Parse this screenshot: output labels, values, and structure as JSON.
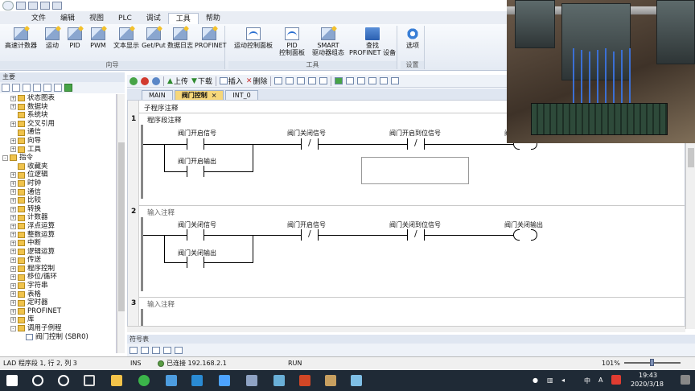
{
  "menu": [
    "文件",
    "编辑",
    "视图",
    "PLC",
    "调试",
    "工具",
    "帮助"
  ],
  "menu_active": "工具",
  "ribbon": {
    "group1": {
      "label": "向导",
      "buttons": [
        "高速计数器",
        "运动",
        "PID",
        "PWM",
        "文本显示",
        "Get/Put",
        "数据日志",
        "PROFINET"
      ]
    },
    "group2": {
      "label": "工具",
      "buttons": [
        "运动控制面板",
        "PID\n控制面板",
        "SMART\n驱动器组态",
        "查找\nPROFINET 设备"
      ]
    },
    "group3": {
      "label": "设置",
      "buttons": [
        "选项"
      ]
    }
  },
  "tree": {
    "header": "主要",
    "items": [
      {
        "label": "状态图表",
        "exp": "+",
        "level": 1
      },
      {
        "label": "数据块",
        "exp": "+",
        "level": 1
      },
      {
        "label": "系统块",
        "exp": "",
        "level": 1
      },
      {
        "label": "交叉引用",
        "exp": "+",
        "level": 1
      },
      {
        "label": "通信",
        "exp": "",
        "level": 1
      },
      {
        "label": "向导",
        "exp": "+",
        "level": 1
      },
      {
        "label": "工具",
        "exp": "+",
        "level": 1
      },
      {
        "label": "指令",
        "exp": "-",
        "level": 0
      },
      {
        "label": "收藏夹",
        "exp": "",
        "level": 1
      },
      {
        "label": "位逻辑",
        "exp": "+",
        "level": 1
      },
      {
        "label": "时钟",
        "exp": "+",
        "level": 1
      },
      {
        "label": "通信",
        "exp": "+",
        "level": 1
      },
      {
        "label": "比较",
        "exp": "+",
        "level": 1
      },
      {
        "label": "转换",
        "exp": "+",
        "level": 1
      },
      {
        "label": "计数器",
        "exp": "+",
        "level": 1
      },
      {
        "label": "浮点运算",
        "exp": "+",
        "level": 1
      },
      {
        "label": "整数运算",
        "exp": "+",
        "level": 1
      },
      {
        "label": "中断",
        "exp": "+",
        "level": 1
      },
      {
        "label": "逻辑运算",
        "exp": "+",
        "level": 1
      },
      {
        "label": "传送",
        "exp": "+",
        "level": 1
      },
      {
        "label": "程序控制",
        "exp": "+",
        "level": 1
      },
      {
        "label": "移位/循环",
        "exp": "+",
        "level": 1
      },
      {
        "label": "字符串",
        "exp": "+",
        "level": 1
      },
      {
        "label": "表格",
        "exp": "+",
        "level": 1
      },
      {
        "label": "定时器",
        "exp": "+",
        "level": 1
      },
      {
        "label": "PROFINET",
        "exp": "+",
        "level": 1
      },
      {
        "label": "库",
        "exp": "+",
        "level": 1
      },
      {
        "label": "调用子例程",
        "exp": "-",
        "level": 1
      },
      {
        "label": "阀门控制 (SBR0)",
        "exp": "",
        "level": 2
      }
    ]
  },
  "editor_toolbar": {
    "upload": "上传",
    "download": "下载",
    "insert": "插入",
    "delete": "删除"
  },
  "tabs": [
    {
      "label": "MAIN",
      "active": false,
      "close": false
    },
    {
      "label": "阀门控制",
      "active": true,
      "close": true
    },
    {
      "label": "INT_0",
      "active": false,
      "close": false
    }
  ],
  "editor": {
    "sub_comment": "子程序注释",
    "networks": [
      {
        "no": "1",
        "comment": "程序段注释",
        "contact1": "阀门开启信号",
        "contact2": "阀门关闭信号",
        "contact3": "阀门开启到位信号",
        "coil": "阀",
        "branch": "阀门开启输出"
      },
      {
        "no": "2",
        "comment": "输入注释",
        "contact1": "阀门关闭信号",
        "contact2": "阀门开启信号",
        "contact3": "阀门关闭到位信号",
        "coil": "阀门关闭输出",
        "branch": "阀门关闭输出"
      },
      {
        "no": "3",
        "comment": "输入注释"
      }
    ],
    "nc_symbol": "/"
  },
  "symbol_table": {
    "header": "符号表"
  },
  "status": {
    "mode": "LAD 程序段 1, 行 2, 列 3",
    "ins": "INS",
    "connection": "已连接 192.168.2.1",
    "run": "RUN",
    "zoom": "101%"
  },
  "taskbar": {
    "time": "19:43",
    "date": "2020/3/18",
    "ime": "中",
    "ime2": "A",
    "apps": [
      "start-icon",
      "search-icon",
      "cortana-icon",
      "taskview-icon",
      "explorer-icon",
      "chrome-icon",
      "app-icon",
      "app-icon",
      "app-icon",
      "app-icon",
      "app-icon",
      "powerpoint-icon",
      "app-icon",
      "app-icon"
    ]
  },
  "colors": {
    "active_tab": "#f6d77a",
    "ribbon_blue": "#2b6fd0",
    "run_green": "#47a447",
    "taskbar": "#1f2a36"
  }
}
